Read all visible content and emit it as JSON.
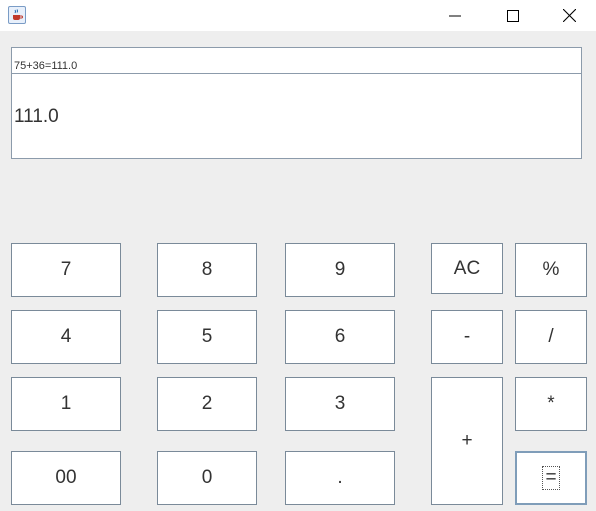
{
  "window": {
    "icon": "java-coffee-icon",
    "controls": [
      "minimize-icon",
      "maximize-icon",
      "close-icon"
    ]
  },
  "display": {
    "history": "75+36=111.0",
    "result": "111.0"
  },
  "keys": {
    "k7": "7",
    "k8": "8",
    "k9": "9",
    "ac": "AC",
    "percent": "%",
    "k4": "4",
    "k5": "5",
    "k6": "6",
    "minus": "-",
    "divide": "/",
    "k1": "1",
    "k2": "2",
    "k3": "3",
    "plus": "+",
    "multiply": "*",
    "k00": "00",
    "k0": "0",
    "dot": ".",
    "equals": "="
  },
  "colors": {
    "background": "#eeeeee",
    "button_border": "#7a8a99",
    "focus_border": "#7f9db9"
  }
}
